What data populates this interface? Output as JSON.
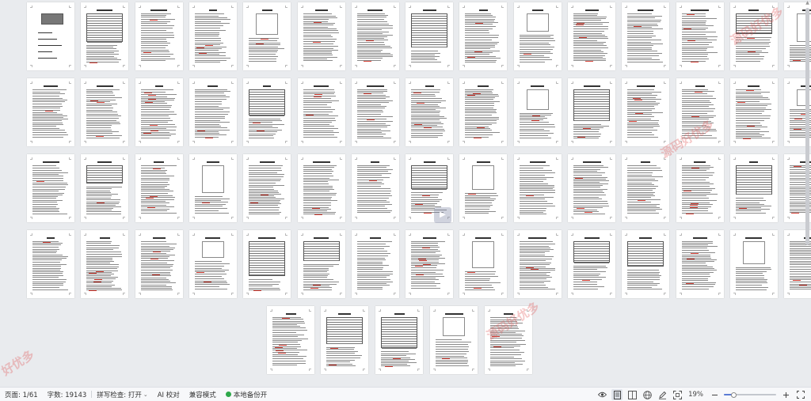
{
  "status": {
    "page_label": "页面: 1/61",
    "word_label": "字数: 19143",
    "spell_label": "拼写检查: 打开",
    "ai_label": "AI 校对",
    "compat_label": "兼容模式",
    "backup_label": "本地备份开",
    "zoom_text": "19%",
    "zoom_fraction": 0.19
  },
  "watermark": {
    "text_right": "源码好优多",
    "text_left": "好优多"
  },
  "thumbnails": {
    "total": 61,
    "rows_full": 4,
    "per_row": 15,
    "last_row": 5
  },
  "icons": {
    "eye": "eye-icon",
    "page_view": "page-view-icon",
    "two_page": "two-page-icon",
    "globe": "web-layout-icon",
    "pen": "edit-icon",
    "fit": "fit-page-icon",
    "minus": "zoom-out-icon",
    "plus": "zoom-in-icon",
    "fullscreen": "fullscreen-icon"
  },
  "colors": {
    "accent": "#5b7bd5",
    "backup_dot": "#2ea84a",
    "watermark": "#e05050"
  }
}
